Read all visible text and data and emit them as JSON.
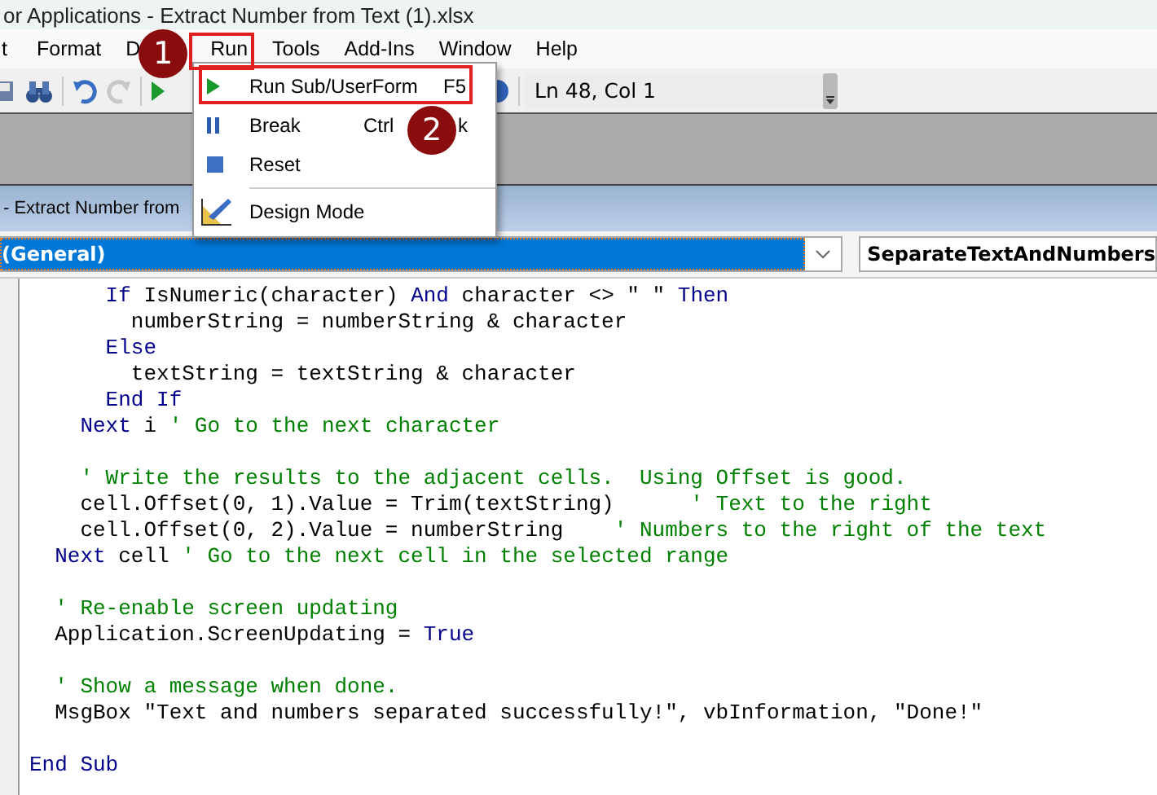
{
  "window": {
    "title": "or Applications - Extract Number from Text (1).xlsx"
  },
  "menu": [
    "t",
    "Format",
    "D",
    "Run",
    "Tools",
    "Add-Ins",
    "Window",
    "Help"
  ],
  "toolbar": {
    "position": "Ln 48, Col 1"
  },
  "run_menu": [
    {
      "kind": "run",
      "label": "Run Sub/UserForm",
      "shortcut": "F5"
    },
    {
      "kind": "break",
      "label": "Break",
      "shortcut_start": "Ctrl",
      "shortcut_end": "k"
    },
    {
      "kind": "reset",
      "label": "Reset"
    },
    {
      "kind": "design",
      "label": "Design Mode"
    }
  ],
  "callouts": [
    "1",
    "2"
  ],
  "code_window": {
    "title": "- Extract Number from",
    "object": "(General)",
    "procedure": "SeparateTextAndNumbers"
  },
  "code": [
    {
      "kind": "line",
      "segments": [
        {
          "kind": "keyword",
          "text": "      If"
        },
        {
          "kind": "code",
          "text": " IsNumeric(character) "
        },
        {
          "kind": "keyword",
          "text": "And"
        },
        {
          "kind": "code",
          "text": " character <> \" \" "
        },
        {
          "kind": "keyword",
          "text": "Then"
        }
      ]
    },
    {
      "kind": "line",
      "segments": [
        {
          "kind": "code",
          "text": "        numberString = numberString & character"
        }
      ]
    },
    {
      "kind": "line",
      "segments": [
        {
          "kind": "keyword",
          "text": "      Else"
        }
      ]
    },
    {
      "kind": "line",
      "segments": [
        {
          "kind": "code",
          "text": "        textString = textString & character"
        }
      ]
    },
    {
      "kind": "line",
      "segments": [
        {
          "kind": "keyword",
          "text": "      End If"
        }
      ]
    },
    {
      "kind": "line",
      "segments": [
        {
          "kind": "keyword",
          "text": "    Next"
        },
        {
          "kind": "code",
          "text": " i "
        },
        {
          "kind": "comment",
          "text": "' Go to the next character"
        }
      ]
    },
    {
      "kind": "blank"
    },
    {
      "kind": "line",
      "segments": [
        {
          "kind": "comment",
          "text": "    ' Write the results to the adjacent cells.  Using Offset is good."
        }
      ]
    },
    {
      "kind": "line",
      "segments": [
        {
          "kind": "code",
          "text": "    cell.Offset(0, 1).Value = Trim(textString)      "
        },
        {
          "kind": "comment",
          "text": "' Text to the right"
        }
      ]
    },
    {
      "kind": "line",
      "segments": [
        {
          "kind": "code",
          "text": "    cell.Offset(0, 2).Value = numberString    "
        },
        {
          "kind": "comment",
          "text": "' Numbers to the right of the text"
        }
      ]
    },
    {
      "kind": "line",
      "segments": [
        {
          "kind": "keyword",
          "text": "  Next"
        },
        {
          "kind": "code",
          "text": " cell "
        },
        {
          "kind": "comment",
          "text": "' Go to the next cell in the selected range"
        }
      ]
    },
    {
      "kind": "blank"
    },
    {
      "kind": "line",
      "segments": [
        {
          "kind": "comment",
          "text": "  ' Re-enable screen updating"
        }
      ]
    },
    {
      "kind": "line",
      "segments": [
        {
          "kind": "code",
          "text": "  Application.ScreenUpdating = "
        },
        {
          "kind": "keyword",
          "text": "True"
        }
      ]
    },
    {
      "kind": "blank"
    },
    {
      "kind": "line",
      "segments": [
        {
          "kind": "comment",
          "text": "  ' Show a message when done."
        }
      ]
    },
    {
      "kind": "line",
      "segments": [
        {
          "kind": "code",
          "text": "  MsgBox \"Text and numbers separated successfully!\", vbInformation, \"Done!\""
        }
      ]
    },
    {
      "kind": "blank"
    },
    {
      "kind": "line",
      "segments": [
        {
          "kind": "keyword",
          "text": "End Sub"
        }
      ]
    }
  ]
}
